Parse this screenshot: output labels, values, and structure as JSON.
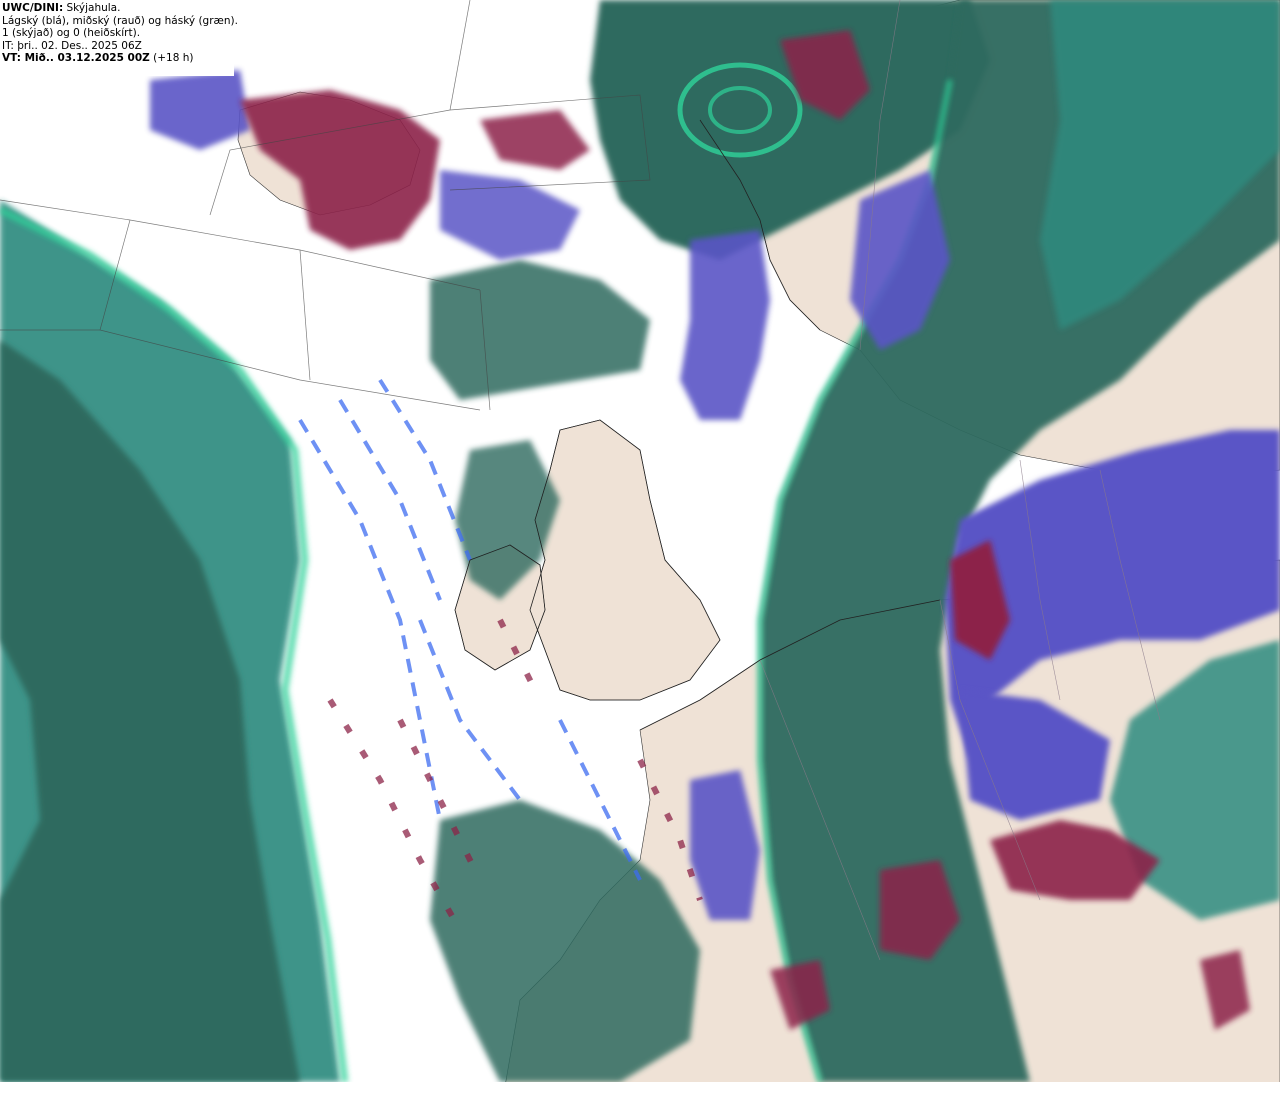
{
  "legend": {
    "model_label": "UWC/DINI:",
    "product_title": "Skýjahula.",
    "layers_description": "Lágský (blá), miðský (rauð) og háský (græn).",
    "scale_description": "1 (skýjað) og 0 (heiðskírt).",
    "issue_time": "IT: þri.. 02. Des.. 2025 06Z",
    "valid_label": "VT: Mið.. 03.12.2025 00Z",
    "lead_time": "(+18 h)"
  },
  "colors": {
    "land": "#efe2d6",
    "sea_clear": "#ffffff",
    "low_cloud": "#5a55c6",
    "low_cloud_edge": "#3d6cf0",
    "mid_cloud": "#8c2448",
    "mid_cloud_edge": "#d9585c",
    "high_cloud": "#2f6a5e",
    "high_cloud_mid": "#2f8c80",
    "high_cloud_edge": "#2fd39a",
    "coastline": "#222222",
    "grid_line": "#444444"
  }
}
